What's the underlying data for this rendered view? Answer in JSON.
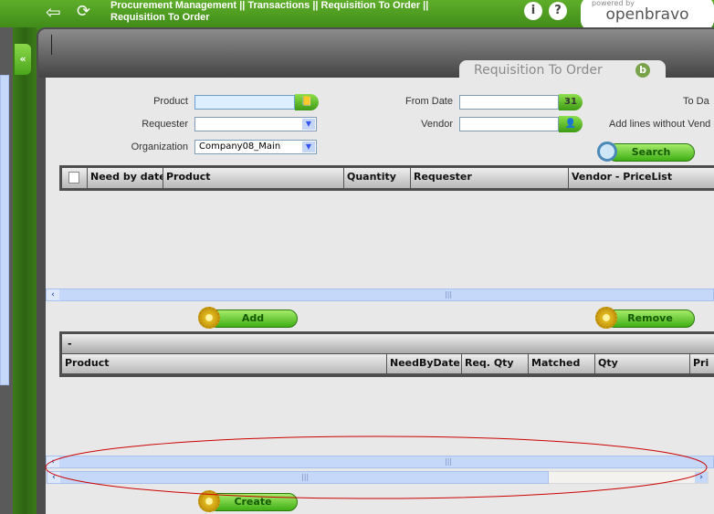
{
  "header": {
    "breadcrumb_line1": "Procurement Management || Transactions || Requisition To Order ||",
    "breadcrumb_line2": "Requisition To Order",
    "logo_powered": "powered by",
    "logo_name": "openbravo",
    "info_icon": "i",
    "help_icon": "?"
  },
  "tab": {
    "title": "Requisition To Order"
  },
  "filters": {
    "product_label": "Product",
    "requester_label": "Requester",
    "organization_label": "Organization",
    "organization_value": "Company08_Main",
    "from_date_label": "From Date",
    "vendor_label": "Vendor",
    "to_date_label": "To Da",
    "add_lines_label": "Add lines without Vend",
    "search_label": "Search",
    "calendar_icon_text": "31"
  },
  "grid1": {
    "columns": [
      "Need by date",
      "Product",
      "Quantity",
      "Requester",
      "Vendor - PriceList"
    ]
  },
  "buttons": {
    "add": "Add",
    "remove": "Remove",
    "create": "Create"
  },
  "grid2": {
    "group_label": "-",
    "columns": [
      "Product",
      "NeedByDate",
      "Req. Qty",
      "Matched",
      "Qty",
      "Pri"
    ]
  },
  "colors": {
    "brand_green": "#4a9a1e",
    "annotation_ellipse": "#cc0000",
    "scrollbar": "#c6d8fa"
  }
}
